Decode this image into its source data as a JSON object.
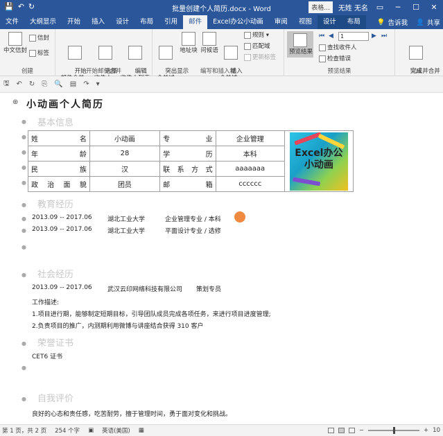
{
  "titlebar": {
    "doc_title": "批量创建个人简历.docx  -  Word",
    "tools_label": "表格...",
    "user": "无姓 无名",
    "qa_save": "💾",
    "qa_undo": "↶",
    "qa_redo": "↻"
  },
  "tabs": [
    {
      "label": "文件",
      "active": false
    },
    {
      "label": "大纲显示",
      "active": false
    },
    {
      "label": "开始",
      "active": false
    },
    {
      "label": "插入",
      "active": false
    },
    {
      "label": "设计",
      "active": false
    },
    {
      "label": "布局",
      "active": false
    },
    {
      "label": "引用",
      "active": false
    },
    {
      "label": "邮件",
      "active": true
    },
    {
      "label": "Excel办公小动画",
      "active": false
    },
    {
      "label": "审阅",
      "active": false
    },
    {
      "label": "视图",
      "active": false
    },
    {
      "label": "设计",
      "active": false,
      "ctx": true
    },
    {
      "label": "布局",
      "active": false,
      "ctx": true
    }
  ],
  "tab_right": {
    "tell_me": "告诉我",
    "share": "共享"
  },
  "ribbon": {
    "create": {
      "label": "创建",
      "chinese_envelope": "中文信封",
      "envelope": "信封",
      "labels": "标签"
    },
    "start_merge": {
      "label": "开始邮件合并",
      "start": "开始\n邮件合并 ▾",
      "select": "选择\n收件人 ▾",
      "edit": "编辑\n收件人列表"
    },
    "write_insert": {
      "label": "编写和插入域",
      "highlight": "突出显示\n合并域",
      "address": "地址块",
      "greeting": "问候语",
      "insert_field": "插入\n合并域 ▾",
      "rules": "规则 ▾",
      "match": "匹配域",
      "update": "更新标签"
    },
    "preview": {
      "label": "预览结果",
      "preview_btn": "预览结果",
      "record": "1",
      "find": "查找收件人",
      "check": "检查错误"
    },
    "finish": {
      "label": "完成",
      "finish_btn": "完成并合并\n▾"
    }
  },
  "document": {
    "heading": "小动画个人简历",
    "sections": {
      "basic": "基本信息",
      "education": "教育经历",
      "social": "社会经历",
      "honors": "荣誉证书",
      "self_eval": "自我评价"
    },
    "table": [
      [
        "姓名",
        "小动画",
        "专业",
        "企业管理"
      ],
      [
        "年龄",
        "28",
        "学历",
        "本科"
      ],
      [
        "民族",
        "汉",
        "联系方式",
        "aaaaaaa"
      ],
      [
        "政治面貌",
        "团员",
        "邮箱",
        "cccccc"
      ]
    ],
    "photo_text": "Excel办公\n小动画",
    "education": [
      {
        "period": "2013.09 -- 2017.06",
        "school": "湖北工业大学",
        "major": "企业管理专业 / 本科"
      },
      {
        "period": "2013.09 -- 2017.06",
        "school": "湖北工业大学",
        "major": "平面设计专业 / 选修"
      }
    ],
    "social": {
      "period": "2013.09 -- 2017.06",
      "company": "武汉云印网络科技有限公司",
      "role": "策划专员",
      "desc_label": "工作描述:",
      "item1": "1.项目进行期，能够制定短期目标，引导团队成员完成各项任务，来进行项目进度管理;",
      "item2": "2.负责项目的推广，内测期利用微博与讲座结合获得 310 客户"
    },
    "honors": "CET6 证书",
    "self_eval": "良好的心态和责任感，吃苦耐劳，擅于管理时间，勇于面对变化和挑战。"
  },
  "status": {
    "page": "第 1 页，共 2 页",
    "words": "254 个字",
    "lang": "英语(美国)",
    "zoom": "10"
  }
}
